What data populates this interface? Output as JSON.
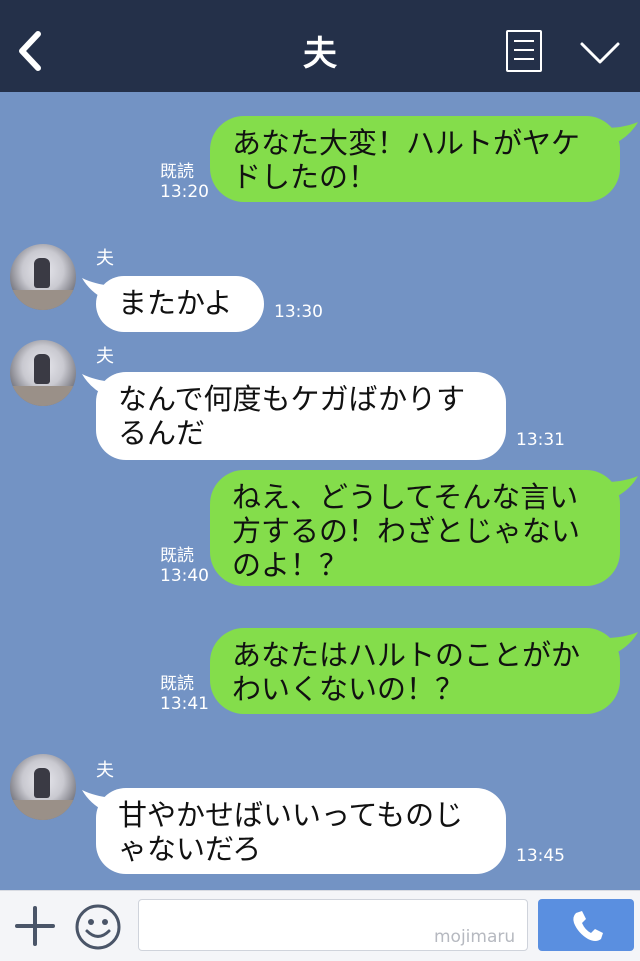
{
  "header": {
    "title": "夫",
    "back_icon": "chevron-left-icon",
    "menu_icon": "document-list-icon",
    "collapse_icon": "chevron-down-icon"
  },
  "colors": {
    "header_bg": "#243049",
    "chat_bg": "#7393c4",
    "my_bubble": "#84dd4b",
    "their_bubble": "#ffffff",
    "call_button": "#5a8fe0"
  },
  "messages": [
    {
      "from": "me",
      "lines": [
        "あなた大変！ハルトがヤケ",
        "ドしたの！"
      ],
      "read": "既読",
      "time": "13:20"
    },
    {
      "from": "them",
      "sender": "夫",
      "lines": [
        "またかよ"
      ],
      "time": "13:30"
    },
    {
      "from": "them",
      "sender": "夫",
      "lines": [
        "なんで何度もケガばかりす",
        "るんだ"
      ],
      "time": "13:31"
    },
    {
      "from": "me",
      "lines": [
        "ねえ、どうしてそんな言い",
        "方するの！わざとじゃない",
        "のよ！？"
      ],
      "read": "既読",
      "time": "13:40"
    },
    {
      "from": "me",
      "lines": [
        "あなたはハルトのことがか",
        "わいくないの！？"
      ],
      "read": "既読",
      "time": "13:41"
    },
    {
      "from": "them",
      "sender": "夫",
      "lines": [
        "甘やかせばいいってものじ",
        "ゃないだろ"
      ],
      "time": "13:45"
    }
  ],
  "input": {
    "placeholder": "",
    "watermark": "mojimaru",
    "plus_icon": "plus-icon",
    "emoji_icon": "smiley-icon",
    "call_icon": "phone-icon"
  }
}
